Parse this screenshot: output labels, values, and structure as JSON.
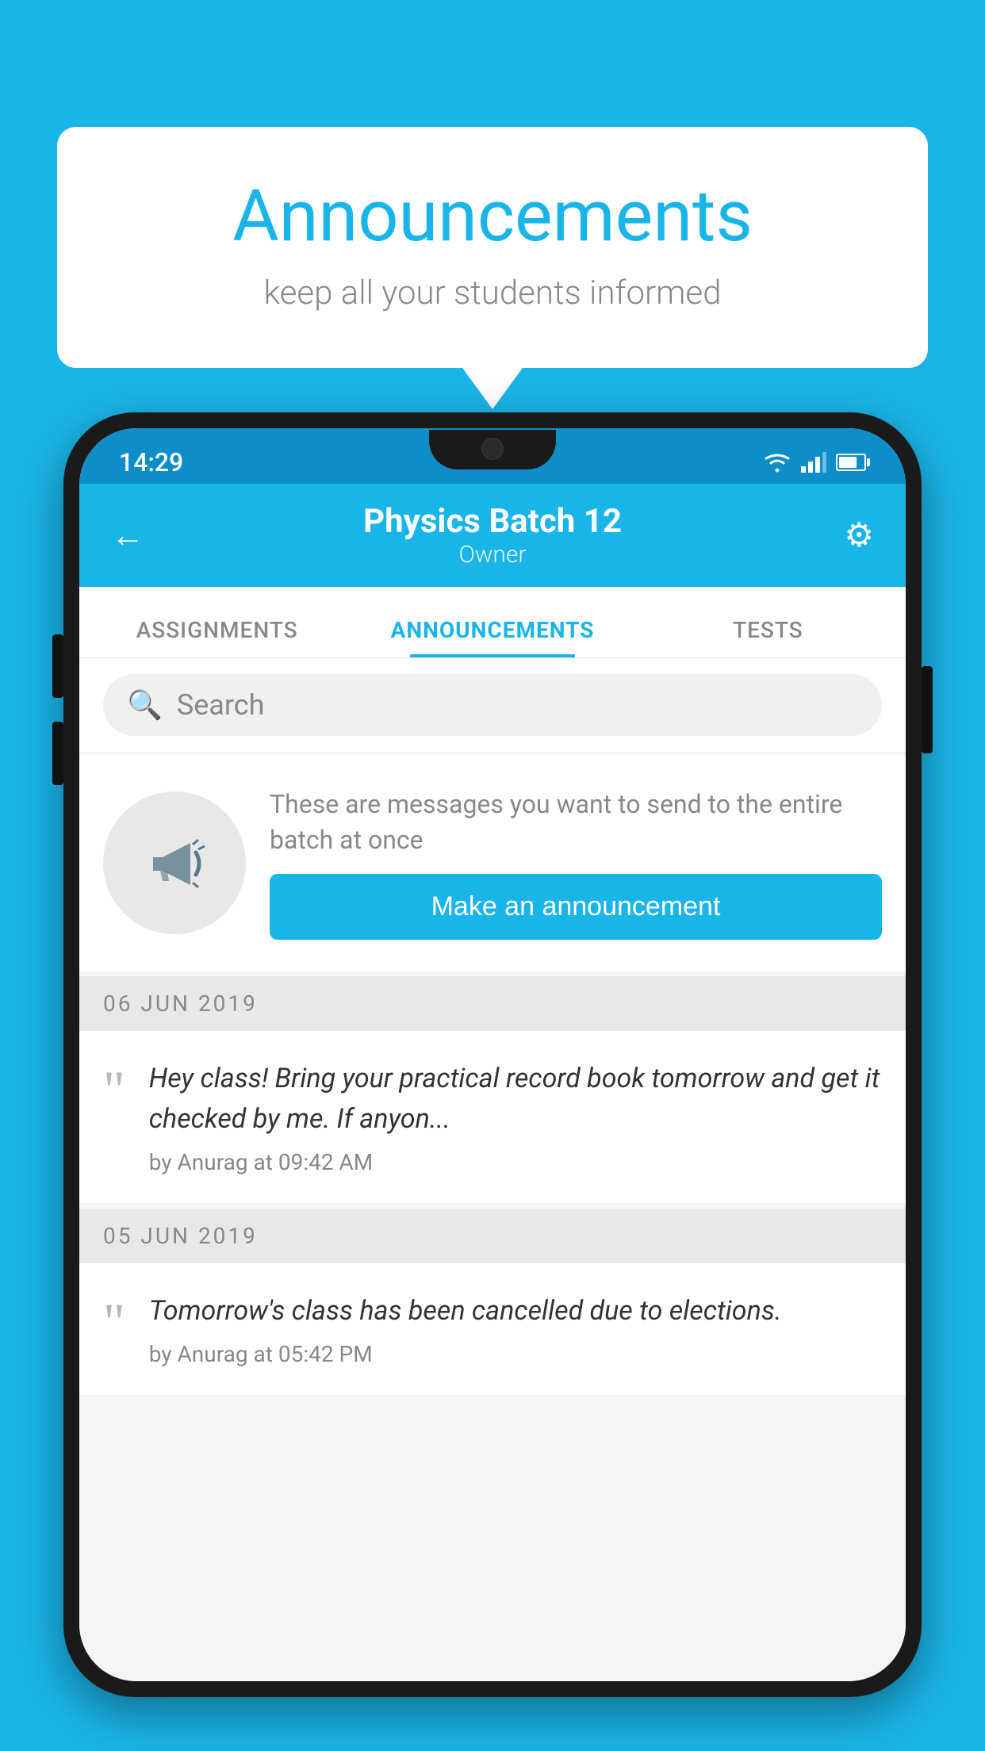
{
  "background_color": "#1ab5e8",
  "speech_bubble": {
    "title": "Announcements",
    "subtitle": "keep all your students informed"
  },
  "status_bar": {
    "time": "14:29"
  },
  "app_header": {
    "title": "Physics Batch 12",
    "subtitle": "Owner",
    "back_icon": "←",
    "settings_icon": "⚙"
  },
  "tabs": [
    {
      "label": "ASSIGNMENTS",
      "active": false
    },
    {
      "label": "ANNOUNCEMENTS",
      "active": true
    },
    {
      "label": "TESTS",
      "active": false
    }
  ],
  "search": {
    "placeholder": "Search"
  },
  "announcement_promo": {
    "description_text": "These are messages you want to send to the entire batch at once",
    "button_label": "Make an announcement"
  },
  "announcements": [
    {
      "date": "06  JUN  2019",
      "text": "Hey class! Bring your practical record book tomorrow and get it checked by me. If anyon...",
      "meta": "by Anurag at 09:42 AM"
    },
    {
      "date": "05  JUN  2019",
      "text": "Tomorrow's class has been cancelled due to elections.",
      "meta": "by Anurag at 05:42 PM"
    }
  ]
}
